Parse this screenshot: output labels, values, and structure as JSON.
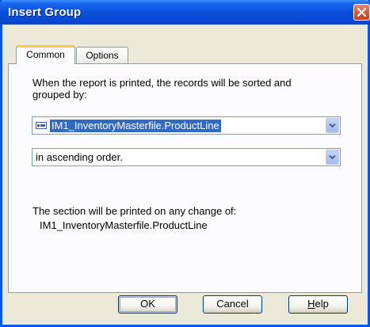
{
  "window": {
    "title": "Insert Group"
  },
  "tabs": [
    {
      "label": "Common",
      "active": true
    },
    {
      "label": "Options",
      "active": false
    }
  ],
  "common": {
    "description_line1": "When the report is printed, the records will be sorted and",
    "description_line2": "grouped by:",
    "group_field": {
      "value": "IM1_InventoryMasterfile.ProductLine",
      "icon": "database-field-icon"
    },
    "sort_order": {
      "value": "in ascending order."
    },
    "change_label": "The section will be printed on any change of:",
    "change_value": "IM1_InventoryMasterfile.ProductLine"
  },
  "buttons": {
    "ok": "OK",
    "cancel": "Cancel",
    "help_first": "H",
    "help_rest": "elp"
  },
  "colors": {
    "title_bar": "#0a4fda",
    "selection": "#316ac5",
    "close_button": "#d95a3a"
  }
}
